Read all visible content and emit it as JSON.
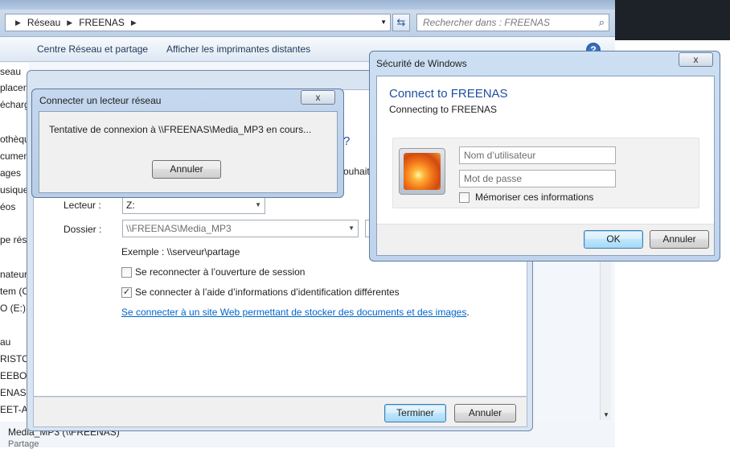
{
  "explorer": {
    "breadcrumb": [
      "Réseau",
      "FREENAS"
    ],
    "search_placeholder": "Rechercher dans : FREENAS",
    "toolbar": {
      "network_center": "Centre Réseau et partage",
      "remote_printers": "Afficher les imprimantes distantes"
    },
    "sidebar_items": [
      "seau",
      "placer",
      "écharg",
      "othèqu",
      "cumen",
      "ages",
      "usique",
      "éos",
      "pe rés",
      "nateur",
      "tem (C",
      "O (E:)",
      "au",
      "RISTO",
      "EEBOX",
      "ENAS",
      "EET-A"
    ],
    "status": {
      "item_name": "Media_MP3 (\\\\FREENAS)",
      "item_type": "Partage"
    }
  },
  "wizard": {
    "fragment_question": "?",
    "fragment_souhaite": "ouhaite",
    "drive_label": "Lecteur :",
    "drive_value": "Z:",
    "folder_label": "Dossier :",
    "folder_value": "\\\\FREENAS\\Media_MP3",
    "example": "Exemple : \\\\serveur\\partage",
    "reconnect_label": "Se reconnecter à l’ouverture de session",
    "reconnect_checked": false,
    "diff_creds_label": "Se connecter à l’aide d’informations d’identification différentes",
    "diff_creds_checked": true,
    "web_link": "Se connecter à un site Web permettant de stocker des documents et des images",
    "finish": "Terminer",
    "cancel": "Annuler"
  },
  "connecting": {
    "title": "Connecter un lecteur réseau",
    "message": "Tentative de connexion à \\\\FREENAS\\Media_MP3 en cours...",
    "cancel": "Annuler",
    "close": "x"
  },
  "security": {
    "title": "Sécurité de Windows",
    "heading": "Connect to FREENAS",
    "subheading": "Connecting to FREENAS",
    "username_placeholder": "Nom d’utilisateur",
    "password_placeholder": "Mot de passe",
    "remember_label": "Mémoriser ces informations",
    "remember_checked": false,
    "ok": "OK",
    "cancel": "Annuler",
    "close": "x"
  }
}
